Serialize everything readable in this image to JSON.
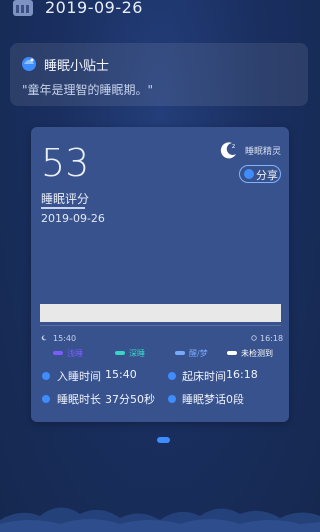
{
  "header": {
    "date": "2019-09-26"
  },
  "tip": {
    "title": "睡眠小贴士",
    "text": "\"童年是理智的睡眠期。\""
  },
  "card": {
    "score": "53",
    "score_label": "睡眠评分",
    "date": "2019-09-26",
    "sprite_label": "睡眠精灵",
    "share_label": "分享",
    "bar_progress_percent": 100,
    "time_start": "15:40",
    "time_end": "16:18",
    "legend": [
      {
        "label": "浅睡",
        "color": "#7b5cff"
      },
      {
        "label": "深睡",
        "color": "#37d6c4"
      },
      {
        "label": "醒/梦",
        "color": "#79a9ff"
      },
      {
        "label": "未检测到",
        "color": "#ffffff"
      }
    ],
    "stats": {
      "sleep_time_label": "入睡时间",
      "sleep_time_value": "15:40",
      "wake_time_label": "起床时间",
      "wake_time_value": "16:18",
      "duration_label": "睡眠时长",
      "duration_value": "37分50秒",
      "dream_talk_label": "睡眠梦话",
      "dream_talk_value": "0段"
    }
  },
  "colors": {
    "accent": "#3f8cff",
    "card_bg": "#38528d",
    "page_bg": "#1a2f60"
  }
}
